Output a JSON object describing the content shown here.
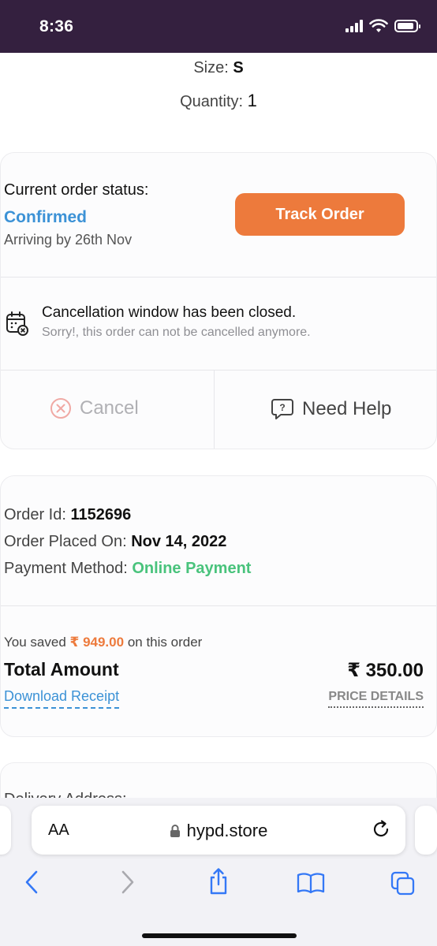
{
  "status_bar": {
    "time": "8:36",
    "battery_level": 0.9
  },
  "product": {
    "size_label": "Size:",
    "size_value": "S",
    "quantity_label": "Quantity:",
    "quantity_value": "1"
  },
  "order_status": {
    "label": "Current order status:",
    "value": "Confirmed",
    "arriving": "Arriving by 26th Nov",
    "track_button": "Track Order"
  },
  "cancellation": {
    "title": "Cancellation window has been closed.",
    "subtitle": "Sorry!, this order can not be cancelled anymore."
  },
  "actions": {
    "cancel": "Cancel",
    "need_help": "Need Help"
  },
  "order_info": {
    "id_label": "Order Id:",
    "id_value": "1152696",
    "placed_label": "Order Placed On:",
    "placed_value": "Nov 14, 2022",
    "payment_label": "Payment Method:",
    "payment_value": "Online Payment"
  },
  "price": {
    "saved_prefix": "You saved",
    "saved_amount": "₹ 949.00",
    "saved_suffix": "on this order",
    "total_label": "Total Amount",
    "total_value": "₹ 350.00",
    "download_receipt": "Download Receipt",
    "price_details": "PRICE DETAILS"
  },
  "delivery": {
    "label": "Delivery Address:"
  },
  "browser": {
    "aa": "AA",
    "url": "hypd.store"
  },
  "colors": {
    "brand_orange": "#ed7a3c",
    "link_blue": "#3c92d6",
    "success_green": "#49c37c",
    "status_bar_bg": "#34203f"
  }
}
